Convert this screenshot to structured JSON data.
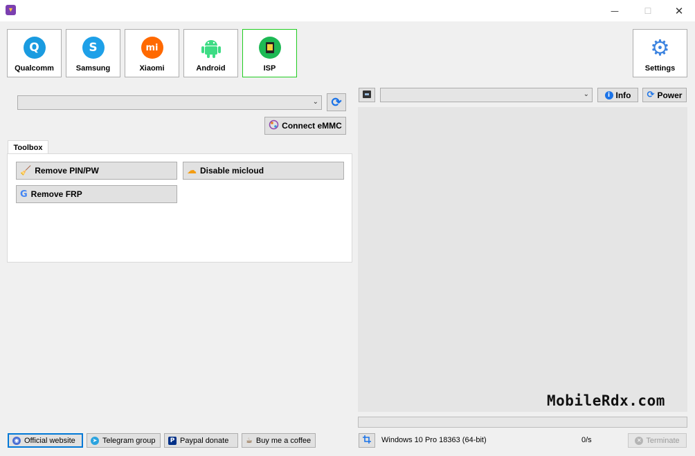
{
  "window": {
    "min_glyph": "—",
    "max_glyph": "☐",
    "close_glyph": "✕"
  },
  "brands": [
    {
      "label": "Qualcomm",
      "glyph": "Q",
      "color": "#1a9be0"
    },
    {
      "label": "Samsung",
      "glyph": "S",
      "color": "#1ea0e8"
    },
    {
      "label": "Xiaomi",
      "glyph": "mi",
      "color": "#ff6900"
    },
    {
      "label": "Android",
      "glyph": "🤖",
      "color": "#3ddc84"
    },
    {
      "label": "ISP",
      "glyph": "▮",
      "color": "#1db954"
    }
  ],
  "settings": {
    "label": "Settings",
    "glyph": "⚙",
    "color": "#3d84e0"
  },
  "device": {
    "port_value": "",
    "refresh_glyph": "⟳",
    "connect_emmc_label": "Connect eMMC"
  },
  "toolbox": {
    "tab_label": "Toolbox",
    "buttons": [
      {
        "label": "Remove PIN/PW",
        "glyph": "🧹"
      },
      {
        "label": "Disable micloud",
        "glyph": "☁"
      },
      {
        "label": "Remove FRP",
        "glyph": "G"
      }
    ]
  },
  "right_panel": {
    "device_value": "",
    "info_label": "Info",
    "power_label": "Power",
    "watermark": "MobileRdx.com",
    "progress": 0
  },
  "footer": {
    "links": [
      {
        "label": "Official website",
        "glyph": "🌐"
      },
      {
        "label": "Telegram group",
        "glyph": "➤"
      },
      {
        "label": "Paypal donate",
        "glyph": "P"
      },
      {
        "label": "Buy me a coffee",
        "glyph": "☕"
      }
    ],
    "os_info": "Windows 10 Pro 18363 (64-bit)",
    "speed": "0/s",
    "terminate_label": "Terminate"
  },
  "colors": {
    "active_border": "#1fcc1f",
    "focus_border": "#0078d7",
    "info_blue": "#1a73e8"
  }
}
